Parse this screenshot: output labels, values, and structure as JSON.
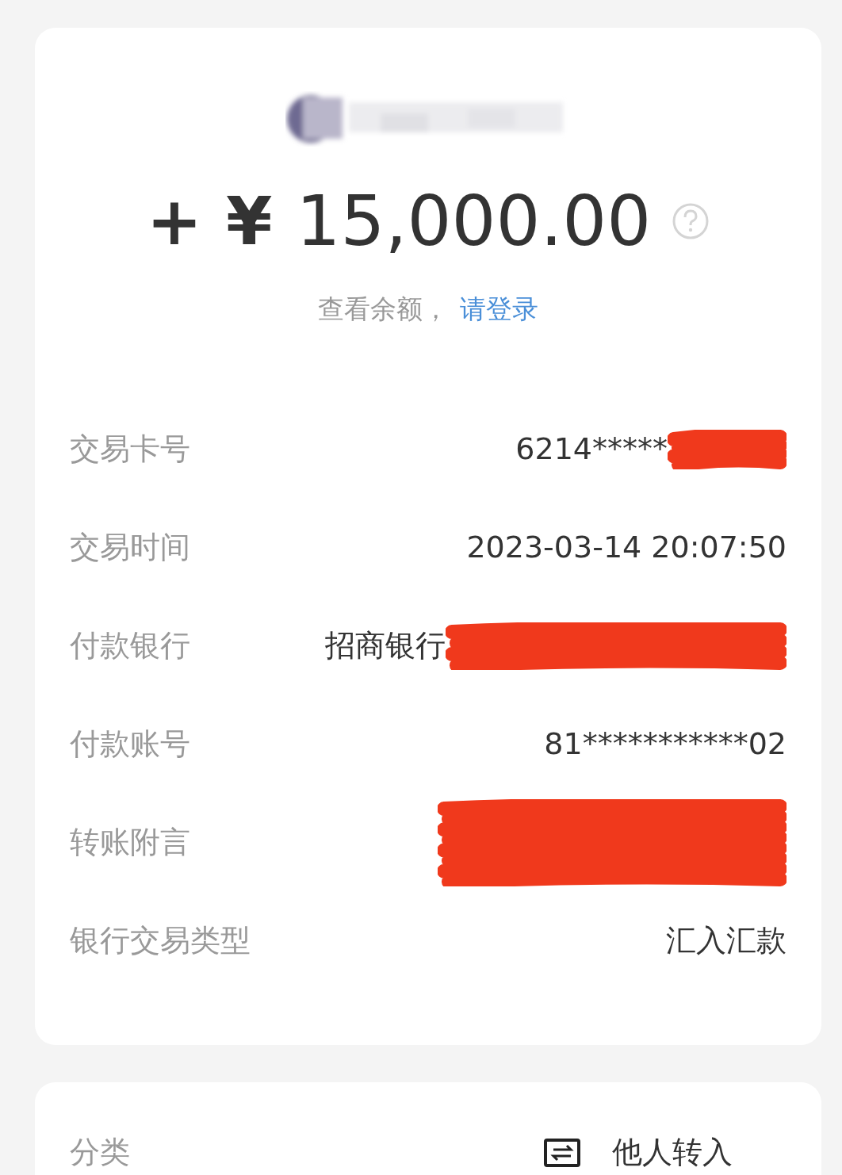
{
  "amount": {
    "sign": "+",
    "currency": "¥",
    "value": "15,000.00"
  },
  "balance_hint": {
    "text": "查看余额，",
    "link": "请登录"
  },
  "details": [
    {
      "label": "交易卡号",
      "value": "6214*****",
      "redacted": true
    },
    {
      "label": "交易时间",
      "value": "2023-03-14 20:07:50",
      "redacted": false
    },
    {
      "label": "付款银行",
      "value": "招商银行",
      "redacted": true
    },
    {
      "label": "付款账号",
      "value": "81***********02",
      "redacted": false
    },
    {
      "label": "转账附言",
      "redacted": true
    },
    {
      "label": "银行交易类型",
      "value": "汇入汇款",
      "redacted": false
    }
  ],
  "category": {
    "label": "分类",
    "value": "他人转入"
  }
}
